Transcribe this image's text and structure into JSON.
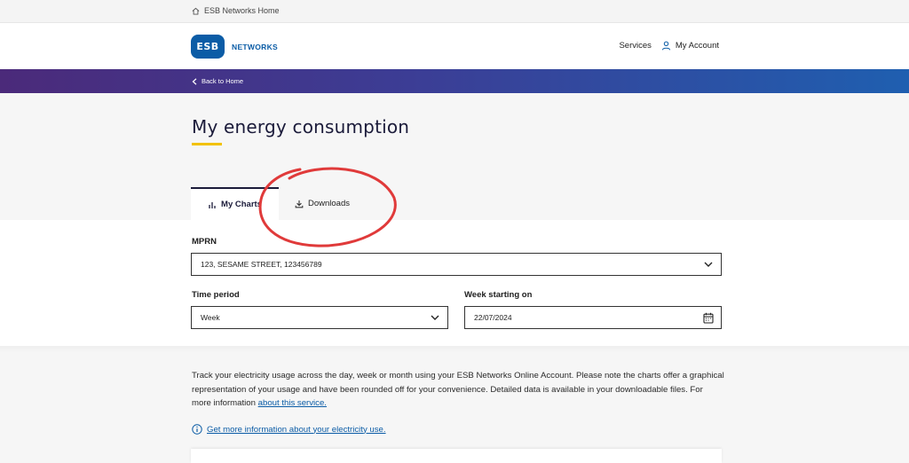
{
  "topbar": {
    "home_label": "ESB Networks Home"
  },
  "header": {
    "logo_badge": "ESB",
    "logo_word": "NETWORKS",
    "services_label": "Services",
    "account_label": "My Account"
  },
  "band": {
    "back_label": "Back to Home"
  },
  "page": {
    "title": "My energy consumption"
  },
  "tabs": [
    {
      "label": "My Charts",
      "active": true
    },
    {
      "label": "Downloads",
      "active": false
    }
  ],
  "form": {
    "mprn_label": "MPRN",
    "mprn_value": "123, SESAME STREET, 123456789",
    "time_period_label": "Time period",
    "time_period_value": "Week",
    "week_start_label": "Week starting on",
    "week_start_value": "22/07/2024"
  },
  "content": {
    "description": "Track your electricity usage across the day, week or month using your ESB Networks Online Account. Please note the charts offer a graphical representation of your usage and have been rounded off for your convenience. Detailed data is available in your downloadable files. For more information ",
    "about_link": "about this service.",
    "info_link": "Get more information about your electricity use."
  },
  "colors": {
    "brand_blue": "#0b5ca6",
    "navy": "#1b1b3a",
    "accent_yellow": "#f2c200",
    "annotation_red": "#e03a3a"
  },
  "icons": [
    "home-icon",
    "user-icon",
    "chevron-left-icon",
    "bar-chart-icon",
    "download-icon",
    "chevron-down-icon",
    "calendar-icon",
    "info-icon"
  ]
}
